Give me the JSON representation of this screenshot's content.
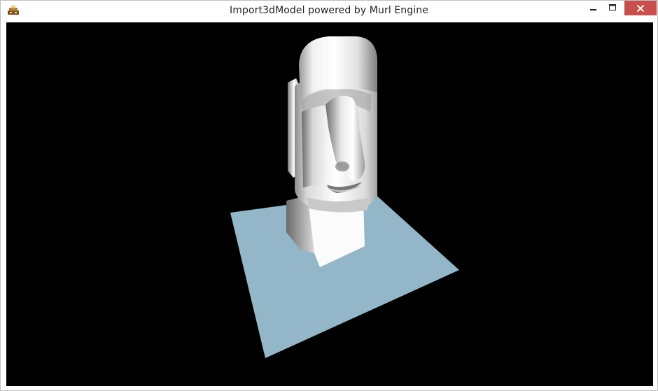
{
  "window": {
    "title": "Import3dModel powered by Murl Engine"
  },
  "title_bar_buttons": {
    "minimize_icon": "minimize-icon",
    "maximize_icon": "maximize-icon",
    "close_icon": "close-icon",
    "close_color": "#c7504e"
  },
  "scene": {
    "background_color": "#000000",
    "floor_color": "#93b7c8",
    "model_color": "#e8e8e8"
  }
}
